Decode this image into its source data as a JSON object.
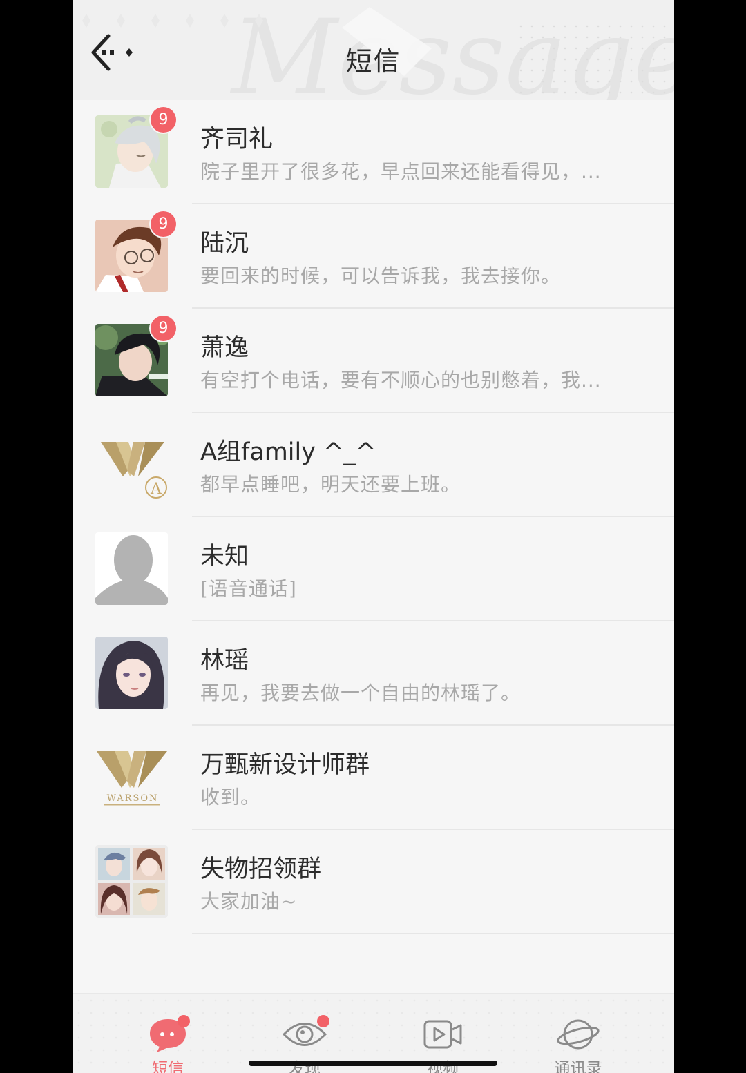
{
  "header": {
    "title": "短信",
    "watermark": "Message"
  },
  "conversations": [
    {
      "name": "齐司礼",
      "preview": "院子里开了很多花，早点回来还能看得见，...",
      "unread": "9",
      "avatar": "qi-silu-portrait"
    },
    {
      "name": "陆沉",
      "preview": "要回来的时候，可以告诉我，我去接你。",
      "unread": "9",
      "avatar": "lu-chen-portrait"
    },
    {
      "name": "萧逸",
      "preview": "有空打个电话，要有不顺心的也别憋着，我...",
      "unread": "9",
      "avatar": "xiao-yi-portrait"
    },
    {
      "name": "A组family ^_^",
      "preview": "都早点睡吧，明天还要上班。",
      "unread": "",
      "avatar": "warson-a-logo",
      "logo_text": "A"
    },
    {
      "name": "未知",
      "preview": "[语音通话]",
      "unread": "",
      "avatar": "unknown-person-silhouette"
    },
    {
      "name": "林瑶",
      "preview": "再见，我要去做一个自由的林瑶了。",
      "unread": "",
      "avatar": "lin-yao-portrait"
    },
    {
      "name": "万甄新设计师群",
      "preview": "收到。",
      "unread": "",
      "avatar": "warson-logo",
      "logo_text": "WARSON"
    },
    {
      "name": "失物招领群",
      "preview": "大家加油~",
      "unread": "",
      "avatar": "group-collage"
    }
  ],
  "tabbar": {
    "tabs": [
      {
        "label": "短信",
        "icon": "chat-bubble-icon",
        "active": true,
        "dot": true
      },
      {
        "label": "发现",
        "icon": "eye-icon",
        "active": false,
        "dot": true
      },
      {
        "label": "视频",
        "icon": "video-icon",
        "active": false,
        "dot": false
      },
      {
        "label": "通讯录",
        "icon": "planet-icon",
        "active": false,
        "dot": false
      }
    ]
  },
  "colors": {
    "accent": "#f06b72",
    "badge": "#f26167",
    "logo_gold": "#c9b17e"
  }
}
